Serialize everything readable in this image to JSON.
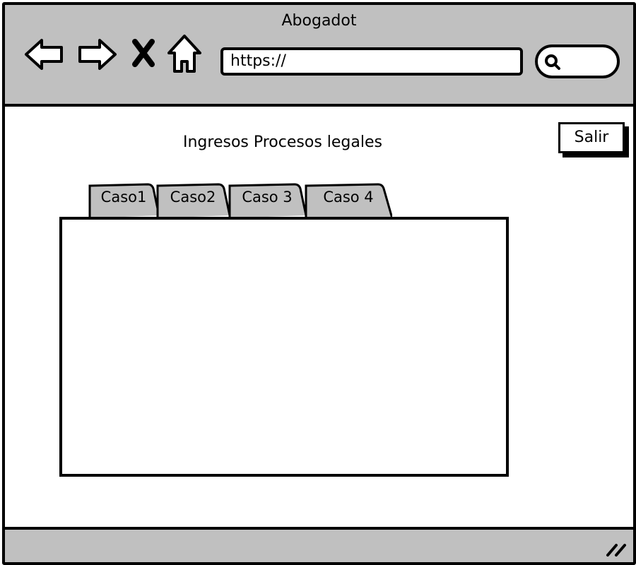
{
  "window": {
    "title": "Abogadot"
  },
  "toolbar": {
    "icons": [
      "back-arrow-icon",
      "forward-arrow-icon",
      "close-x-icon",
      "home-icon",
      "search-icon"
    ],
    "url": "https://"
  },
  "main": {
    "heading": "Ingresos Procesos legales",
    "logout_label": "Salir",
    "tabs": [
      {
        "label": "Caso1"
      },
      {
        "label": "Caso2"
      },
      {
        "label": "Caso 3"
      },
      {
        "label": "Caso 4"
      }
    ]
  },
  "colors": {
    "chrome": "#c0c0c0",
    "border": "#000000",
    "content": "#ffffff"
  }
}
